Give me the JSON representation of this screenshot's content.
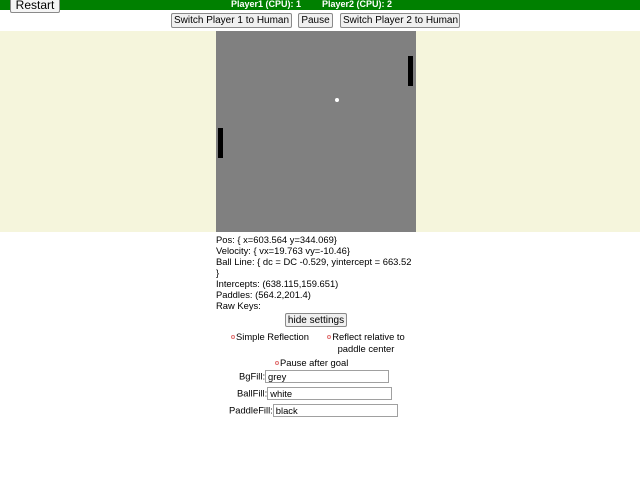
{
  "header": {
    "restart_label": "Restart",
    "player1_score": "Player1 (CPU): 1",
    "player2_score": "Player2 (CPU): 2",
    "bar_color": "#008000"
  },
  "controls": {
    "switch_p1_label": "Switch Player 1 to Human",
    "pause_label": "Pause",
    "switch_p2_label": "Switch Player 2 to Human"
  },
  "court": {
    "background_color": "#808080",
    "ball_color": "#ffffff",
    "paddle_color": "#000000",
    "page_background": "#f5f5dc"
  },
  "debug": {
    "pos": "Pos: { x=603.564 y=344.069}",
    "velocity": "Velocity: { vx=19.763 vy=-10.46}",
    "ball_line": "Ball Line: { dc = DC -0.529, yintercept = 663.52 }",
    "intercepts": "Intercepts: (638.115,159.651)",
    "paddles": "Paddles: (564.2,201.4)",
    "raw_keys": "Raw Keys:"
  },
  "settings": {
    "hide_label": "hide settings",
    "reflection_option_1": "Simple Reflection",
    "reflection_option_2": "Reflect relative to paddle center",
    "pause_after_goal": "Pause after goal",
    "bgfill_label": "BgFill:",
    "bgfill_value": "grey",
    "ballfill_label": "BallFill:",
    "ballfill_value": "white",
    "paddlefill_label": "PaddleFill:",
    "paddlefill_value": "black"
  }
}
